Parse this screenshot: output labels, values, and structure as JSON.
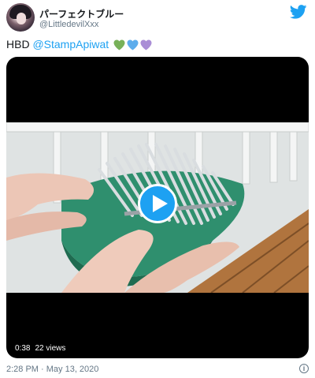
{
  "author": {
    "display_name": "パーフェクトブルー",
    "handle": "@LittledevilXxx"
  },
  "tweet": {
    "text_prefix": "HBD ",
    "mention": "@StampApiwat",
    "hearts": [
      {
        "icon": "green-heart-icon",
        "color": "#78b159"
      },
      {
        "icon": "blue-heart-icon",
        "color": "#5dadec"
      },
      {
        "icon": "purple-heart-icon",
        "color": "#aa8ed6"
      }
    ]
  },
  "video": {
    "duration": "0:38",
    "views": "22 views"
  },
  "footer": {
    "timestamp": "2:28 PM · May 13, 2020"
  },
  "colors": {
    "brand": "#1da1f2",
    "secondary_text": "#657786"
  }
}
